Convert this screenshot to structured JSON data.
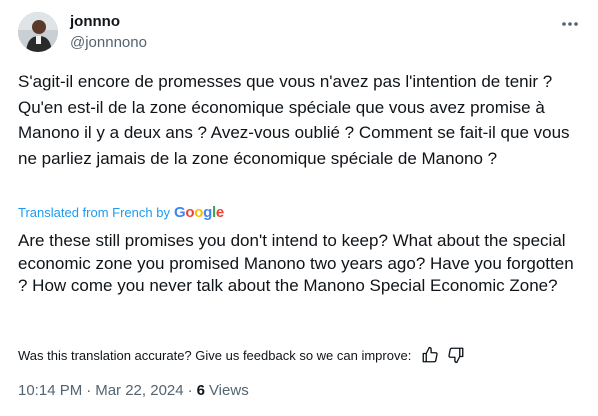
{
  "author": {
    "name": "jonnno",
    "handle": "@jonnnono"
  },
  "icons": {
    "more": "more-icon",
    "thumbs_up": "thumbs-up-icon",
    "thumbs_down": "thumbs-down-icon",
    "avatar": "avatar"
  },
  "tweet": {
    "original_text": "S'agit-il encore de promesses que vous n'avez pas l'intention de tenir ? Qu'en est-il de la zone économique spéciale que vous avez promise à Manono il y a deux ans ? Avez-vous oublié ? Comment se fait-il que vous ne parliez jamais de la zone économique spéciale de Manono ?",
    "translated_from_label": "Translated from French by",
    "translator_brand": "Google",
    "translated_text": "Are these still promises you don't intend to keep? What about the special economic zone you promised Manono two years ago? Have you forgotten ? How come you never talk about the Manono Special Economic Zone?",
    "feedback_prompt": "Was this translation accurate? Give us feedback so we can improve:"
  },
  "meta": {
    "time": "10:14 PM",
    "separator": "·",
    "date": "Mar 22, 2024",
    "views_count": "6",
    "views_label": "Views"
  },
  "colors": {
    "text": "#0f1419",
    "muted": "#536471",
    "link": "#1d9bf0"
  }
}
